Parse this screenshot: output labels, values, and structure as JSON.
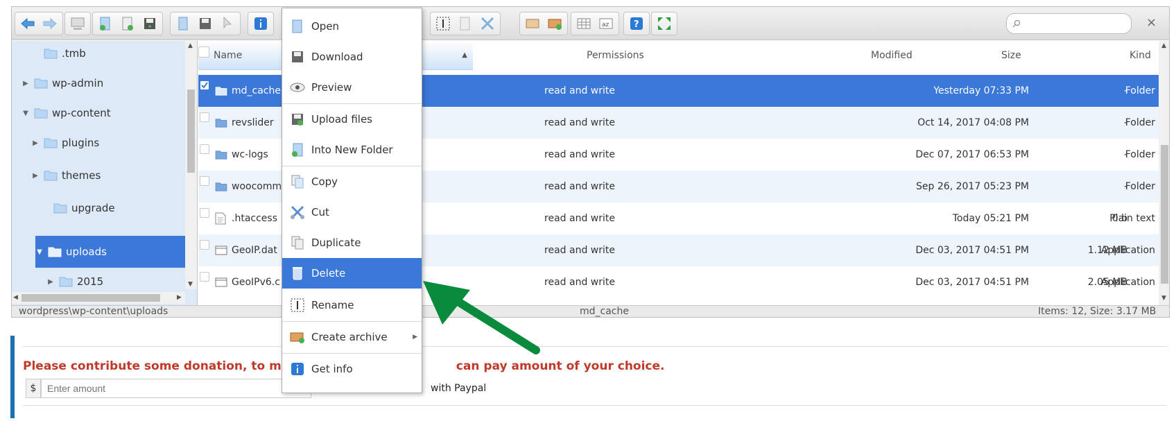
{
  "search": {
    "placeholder": ""
  },
  "tree": {
    "items": [
      {
        "label": ".tmb",
        "expanded": null
      },
      {
        "label": "wp-admin",
        "expanded": false
      },
      {
        "label": "wp-content",
        "expanded": true
      },
      {
        "label": "plugins",
        "expanded": false
      },
      {
        "label": "themes",
        "expanded": false
      },
      {
        "label": "upgrade",
        "expanded": null
      },
      {
        "label": "uploads",
        "expanded": true,
        "selected": true
      },
      {
        "label": "2015",
        "expanded": false
      }
    ]
  },
  "list": {
    "columns": {
      "name": "Name",
      "permissions": "Permissions",
      "modified": "Modified",
      "size": "Size",
      "kind": "Kind"
    },
    "rows": [
      {
        "name": "md_cache",
        "permissions": "read and write",
        "modified": "Yesterday 07:33 PM",
        "size": "-",
        "kind": "Folder",
        "icon": "folder",
        "selected": true
      },
      {
        "name": "revslider",
        "permissions": "read and write",
        "modified": "Oct 14, 2017 04:08 PM",
        "size": "-",
        "kind": "Folder",
        "icon": "folder"
      },
      {
        "name": "wc-logs",
        "permissions": "read and write",
        "modified": "Dec 07, 2017 06:53 PM",
        "size": "-",
        "kind": "Folder",
        "icon": "folder"
      },
      {
        "name": "woocomm",
        "permissions": "read and write",
        "modified": "Sep 26, 2017 05:23 PM",
        "size": "-",
        "kind": "Folder",
        "icon": "folder"
      },
      {
        "name": ".htaccess",
        "permissions": "read and write",
        "modified": "Today 05:21 PM",
        "size": "0 b",
        "kind": "Plain text",
        "icon": "text-file"
      },
      {
        "name": "GeoIP.dat",
        "permissions": "read and write",
        "modified": "Dec 03, 2017 04:51 PM",
        "size": "1.12 MB",
        "kind": "Application",
        "icon": "app-file"
      },
      {
        "name": "GeoIPv6.c",
        "permissions": "read and write",
        "modified": "Dec 03, 2017 04:51 PM",
        "size": "2.05 MB",
        "kind": "Application",
        "icon": "app-file"
      }
    ]
  },
  "status": {
    "path": "wordpress\\wp-content\\uploads",
    "selected": "md_cache",
    "summary": "Items: 12, Size: 3.17 MB"
  },
  "context_menu": {
    "items": [
      {
        "label": "Open",
        "icon": "open-icon"
      },
      {
        "label": "Download",
        "icon": "download-icon"
      },
      {
        "label": "Preview",
        "icon": "eye-icon"
      },
      {
        "label": "Upload files",
        "icon": "upload-icon"
      },
      {
        "label": "Into New Folder",
        "icon": "new-folder-icon"
      },
      {
        "label": "Copy",
        "icon": "copy-icon"
      },
      {
        "label": "Cut",
        "icon": "scissors-icon"
      },
      {
        "label": "Duplicate",
        "icon": "duplicate-icon"
      },
      {
        "label": "Delete",
        "icon": "trash-icon",
        "highlighted": true
      },
      {
        "label": "Rename",
        "icon": "rename-icon"
      },
      {
        "label": "Create archive",
        "icon": "archive-icon",
        "submenu": true
      },
      {
        "label": "Get info",
        "icon": "info-icon"
      }
    ]
  },
  "donation": {
    "message_left": "Please contribute some donation, to make p",
    "message_right": "can pay amount of your choice.",
    "currency": "$",
    "amount_placeholder": "Enter amount",
    "paypal_text": "with Paypal"
  },
  "colors": {
    "selection": "#3b78d8",
    "tree_bg": "#dde9f7",
    "annotation_arrow": "#0a8a3c",
    "donation_text": "#c0392b",
    "donation_border": "#1e6fb5"
  }
}
